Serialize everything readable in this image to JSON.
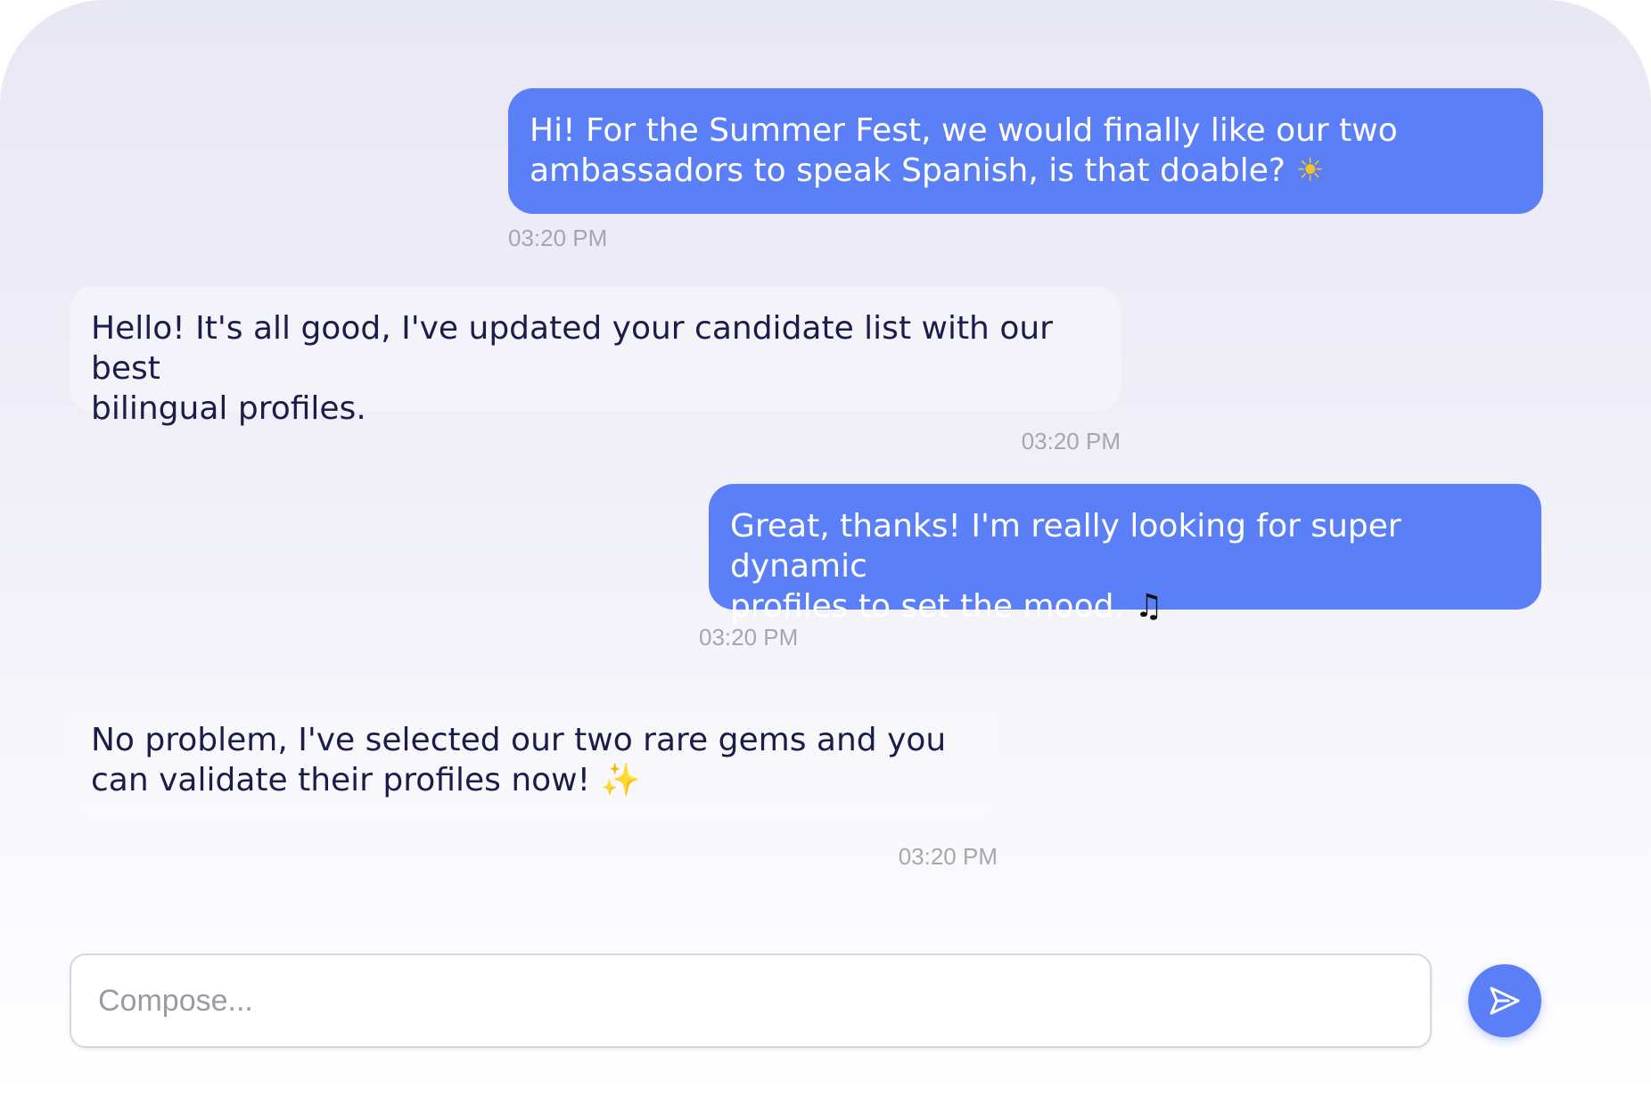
{
  "messages": [
    {
      "direction": "outgoing",
      "lines": [
        "Hi! For the Summer Fest, we would finally like our two",
        "ambassadors to speak Spanish, is that doable?"
      ],
      "emoji": "☀",
      "time": "03:20 PM"
    },
    {
      "direction": "incoming",
      "lines": [
        "Hello! It's all good, I've updated your candidate list with our best",
        "bilingual profiles."
      ],
      "time": "03:20 PM"
    },
    {
      "direction": "outgoing",
      "lines": [
        "Great, thanks! I'm really looking for super dynamic",
        "profiles to set the mood."
      ],
      "emoji": "♫",
      "time": "03:20 PM"
    },
    {
      "direction": "incoming",
      "lines": [
        "No problem, I've selected our two rare gems and you",
        "can validate their profiles now!"
      ],
      "emoji": "✨",
      "time": "03:20 PM"
    }
  ],
  "compose": {
    "placeholder": "Compose..."
  },
  "icons": {
    "send": "send-icon"
  },
  "colors": {
    "accent": "#5b7ff7",
    "incoming_bubble": "#f4f3f9",
    "incoming_text": "#1a1d4a",
    "timestamp": "#a4a6b3"
  }
}
